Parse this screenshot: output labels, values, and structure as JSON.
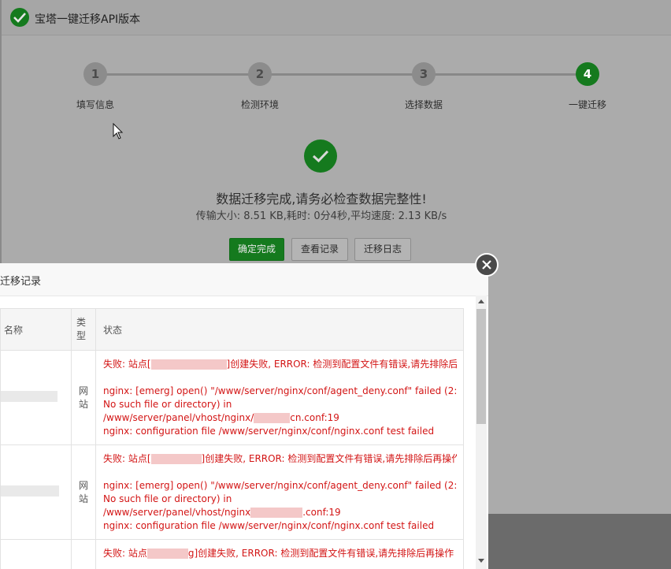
{
  "window": {
    "title": "宝塔一键迁移API版本"
  },
  "steps": [
    {
      "num": "1",
      "label": "填写信息"
    },
    {
      "num": "2",
      "label": "检测环境"
    },
    {
      "num": "3",
      "label": "选择数据"
    },
    {
      "num": "4",
      "label": "一键迁移"
    }
  ],
  "result": {
    "title": "数据迁移完成,请务必检查数据完整性!",
    "stats": "传输大小: 8.51 KB,耗时: 0分4秒,平均速度: 2.13 KB/s"
  },
  "buttons": {
    "confirm": "确定完成",
    "view_records": "查看记录",
    "migrate_log": "迁移日志"
  },
  "colors": {
    "accent": "#157a1e",
    "error": "#d31515"
  },
  "modal": {
    "title": "迁移记录",
    "columns": {
      "name": "名称",
      "type": "类型",
      "status": "状态"
    },
    "rows": [
      {
        "type": "网站",
        "status_prefix": "失败: 站点[",
        "status_suffix": "]创建失败, ERROR: 检测到配置文件有错误,请先排除后再操作",
        "lines": [
          "nginx: [emerg] open() \"/www/server/nginx/conf/agent_deny.conf\" failed (2:",
          "No such file or directory) in"
        ],
        "vhost_prefix": "/www/server/panel/vhost/nginx/",
        "vhost_suffix": "cn.conf:19",
        "last": "nginx: configuration file /www/server/nginx/conf/nginx.conf test failed"
      },
      {
        "type": "网站",
        "status_prefix": "失败: 站点[",
        "status_suffix": "]创建失败, ERROR: 检测到配置文件有错误,请先排除后再操作",
        "lines": [
          "nginx: [emerg] open() \"/www/server/nginx/conf/agent_deny.conf\" failed (2:",
          "No such file or directory) in"
        ],
        "vhost_prefix": "/www/server/panel/vhost/nginx",
        "vhost_suffix": ".conf:19",
        "last": "nginx: configuration file /www/server/nginx/conf/nginx.conf test failed"
      },
      {
        "type": "",
        "status_prefix": "失败: 站点",
        "status_suffix": "g]创建失败, ERROR: 检测到配置文件有错误,请先排除后再操作"
      }
    ]
  }
}
